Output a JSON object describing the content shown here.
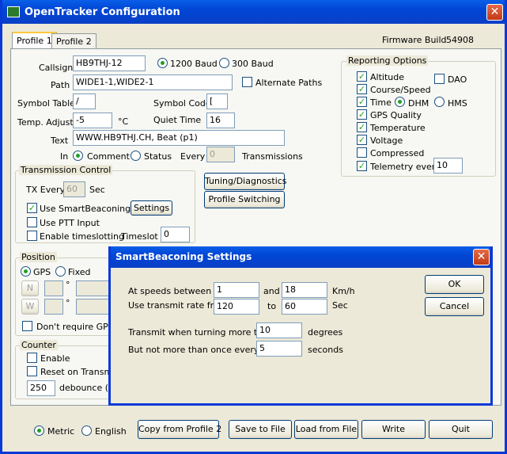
{
  "window": {
    "title": "OpenTracker Configuration",
    "close": "✕"
  },
  "tabs": [
    "Profile 1",
    "Profile 2"
  ],
  "firmware": {
    "label": "Firmware Build",
    "value": "54908"
  },
  "callsign": {
    "label": "Callsign",
    "value": "HB9THJ-12"
  },
  "baud": {
    "opt1": "1200 Baud",
    "opt2": "300 Baud"
  },
  "path": {
    "label": "Path",
    "value": "WIDE1-1,WIDE2-1",
    "alt": "Alternate Paths"
  },
  "symbol_table": {
    "label": "Symbol Table",
    "value": "/"
  },
  "symbol_code": {
    "label": "Symbol Code",
    "value": "["
  },
  "temp": {
    "label": "Temp. Adjust",
    "value": "-5",
    "unit": "°C"
  },
  "quiet": {
    "label": "Quiet Time",
    "value": "16"
  },
  "text": {
    "label": "Text",
    "value": "WWW.HB9THJ.CH, Beat (p1)"
  },
  "in_row": {
    "label": "In",
    "comment": "Comment",
    "status": "Status",
    "every": "Every",
    "every_value": "0",
    "transmissions": "Transmissions"
  },
  "transmission": {
    "title": "Transmission Control",
    "tx_every": "TX Every",
    "tx_value": "60",
    "sec": "Sec",
    "smart": "Use SmartBeaconing",
    "settings": "Settings",
    "ptt": "Use PTT Input",
    "timeslot_enable": "Enable timeslotting",
    "timeslot": "Timeslot",
    "timeslot_value": "0"
  },
  "tuning_button": "Tuning/Diagnostics",
  "profile_switching_button": "Profile Switching",
  "reporting": {
    "title": "Reporting Options",
    "altitude": "Altitude",
    "dao": "DAO",
    "course": "Course/Speed",
    "time": "Time",
    "dhm": "DHM",
    "hms": "HMS",
    "gps_quality": "GPS Quality",
    "temperature": "Temperature",
    "voltage": "Voltage",
    "compressed": "Compressed",
    "telemetry": "Telemetry every",
    "telemetry_value": "10"
  },
  "position": {
    "title": "Position",
    "gps": "GPS",
    "fixed": "Fixed",
    "n": "N",
    "w": "W",
    "deg": "°",
    "dont_require": "Don't require GPS fix"
  },
  "counter": {
    "title": "Counter",
    "enable": "Enable",
    "reset": "Reset on Transmit",
    "debounce_value": "250",
    "debounce_label": "debounce (mS)"
  },
  "units": {
    "metric": "Metric",
    "english": "English"
  },
  "buttons": {
    "copy": "Copy from Profile 2",
    "save": "Save to File",
    "load": "Load from File",
    "write": "Write",
    "quit": "Quit"
  },
  "dialog": {
    "title": "SmartBeaconing Settings",
    "speeds_label": "At speeds between",
    "speed_low": "1",
    "and": "and",
    "speed_high": "18",
    "speed_unit": "Km/h",
    "rate_label": "Use transmit rate from",
    "rate_low": "120",
    "to": "to",
    "rate_high": "60",
    "rate_unit": "Sec",
    "turn_label": "Transmit when turning more than",
    "turn_value": "10",
    "turn_unit": "degrees",
    "once_label": "But not more than once every",
    "once_value": "5",
    "once_unit": "seconds",
    "ok": "OK",
    "cancel": "Cancel"
  }
}
